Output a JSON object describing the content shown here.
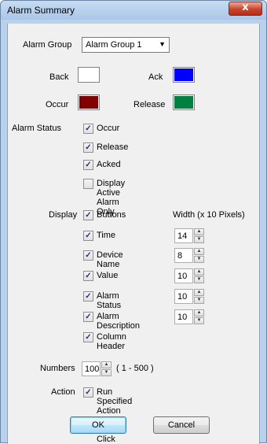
{
  "window": {
    "title": "Alarm Summary",
    "close_glyph": "x"
  },
  "alarm_group": {
    "label": "Alarm Group",
    "selected": "Alarm Group 1",
    "arrow": "▼"
  },
  "colors": {
    "back": {
      "label": "Back",
      "value": "#ffffff"
    },
    "ack": {
      "label": "Ack",
      "value": "#0000ff"
    },
    "occur": {
      "label": "Occur",
      "value": "#800000"
    },
    "release": {
      "label": "Release",
      "value": "#008040"
    }
  },
  "alarm_status": {
    "label": "Alarm Status",
    "items": [
      {
        "label": "Occur",
        "checked": true
      },
      {
        "label": "Release",
        "checked": true
      },
      {
        "label": "Acked",
        "checked": true
      },
      {
        "label": "Display Active Alarm Only",
        "checked": false
      }
    ]
  },
  "display": {
    "label": "Display",
    "width_header": "Width (x 10 Pixels)",
    "items": [
      {
        "label": "Buttons",
        "checked": true,
        "width": null
      },
      {
        "label": "Time",
        "checked": true,
        "width": "14"
      },
      {
        "label": "Device Name",
        "checked": true,
        "width": "8"
      },
      {
        "label": "Value",
        "checked": true,
        "width": "10"
      },
      {
        "label": "Alarm Status",
        "checked": true,
        "width": "10"
      },
      {
        "label": "Alarm Description",
        "checked": true,
        "width": "10"
      },
      {
        "label": "Column Header",
        "checked": true,
        "width": null
      }
    ]
  },
  "numbers": {
    "label": "Numbers",
    "value": "100",
    "range": "( 1 - 500 )"
  },
  "action": {
    "label": "Action",
    "checkbox_label": "Run Specified Action On Double Click",
    "checked": true
  },
  "buttons": {
    "ok": "OK",
    "cancel": "Cancel"
  },
  "glyphs": {
    "check": "✓",
    "spin_up": "▲",
    "spin_down": "▼"
  }
}
